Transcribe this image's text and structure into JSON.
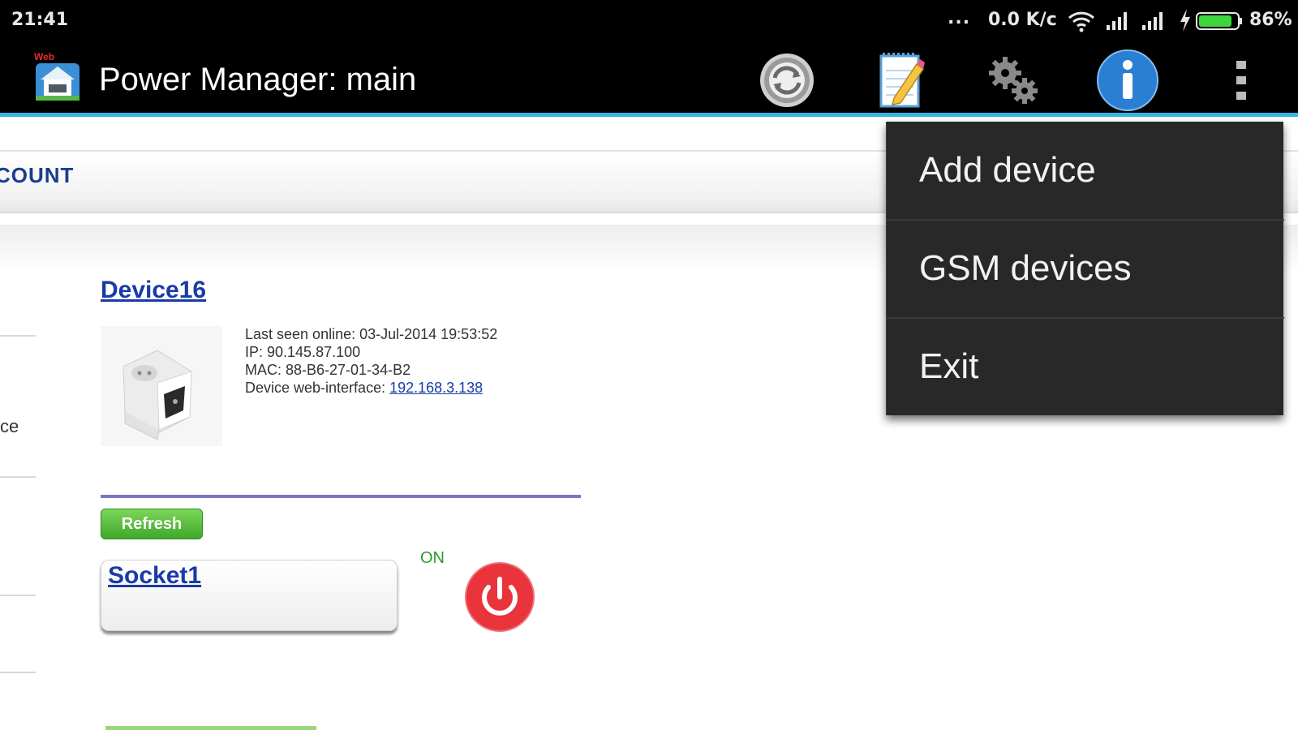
{
  "status_bar": {
    "time": "21:41",
    "dots": "...",
    "network_speed": "0.0 K/c",
    "battery_percent": "86%",
    "battery_level": 0.86,
    "battery_color": "#3dd63d"
  },
  "app_bar": {
    "app_icon_badge": "Web",
    "title": "Power Manager: main",
    "accent_color": "#33b5e5",
    "actions": [
      "refresh-icon",
      "notes-icon",
      "settings-icon",
      "info-icon",
      "overflow-menu-icon"
    ]
  },
  "content": {
    "account_label": "COUNT",
    "left_fragment": "ce",
    "device": {
      "name": "Device16",
      "last_seen": "Last seen online: 03-Jul-2014 19:53:52",
      "ip": "IP: 90.145.87.100",
      "mac": "MAC: 88-B6-27-01-34-B2",
      "web_interface_label": "Device web-interface: ",
      "web_interface_link": "192.168.3.138"
    },
    "refresh_button": "Refresh",
    "socket": {
      "name": "Socket1",
      "status": "ON",
      "power_color": "#e8343a"
    }
  },
  "overflow_menu": {
    "items": [
      {
        "label": "Add device"
      },
      {
        "label": "GSM devices"
      },
      {
        "label": "Exit"
      }
    ]
  }
}
